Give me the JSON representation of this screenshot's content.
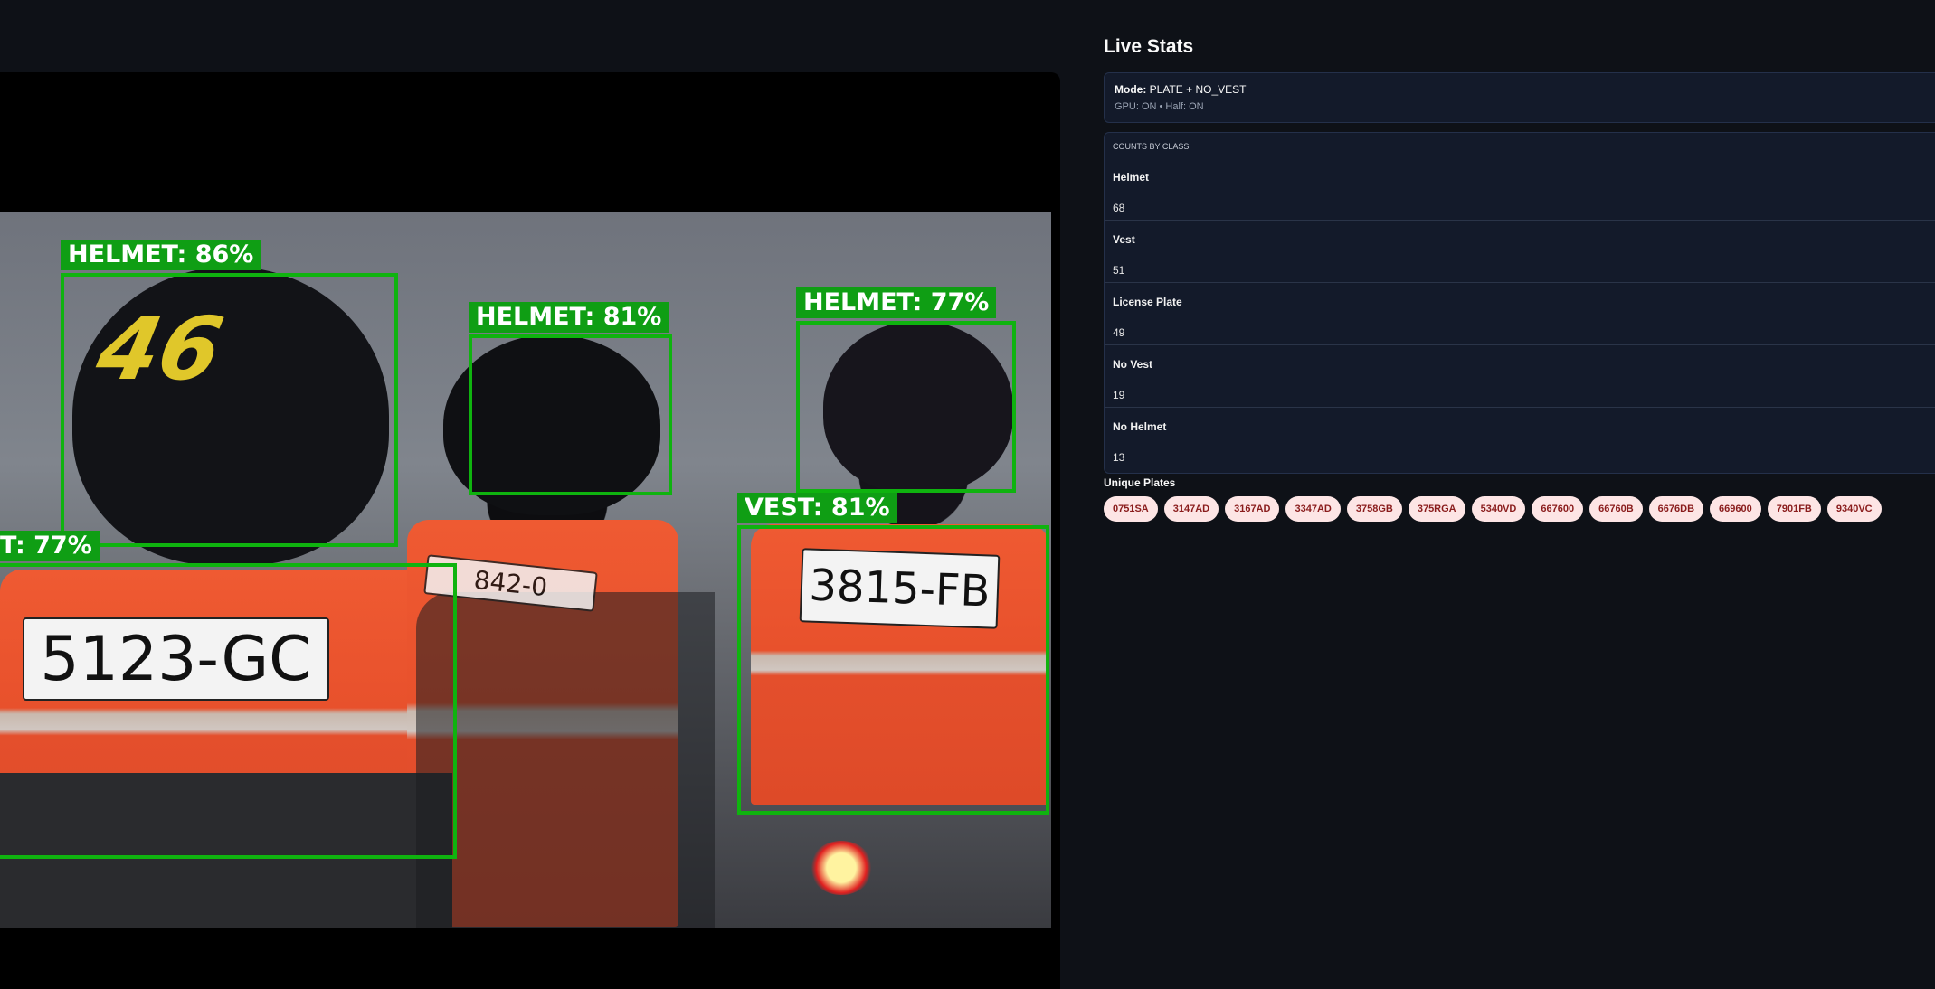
{
  "stats": {
    "title": "Live Stats",
    "mode_label": "Mode:",
    "mode_value": "PLATE + NO_VEST",
    "gpu_line": "GPU: ON • Half: ON",
    "counts_heading": "COUNTS BY CLASS",
    "counts": [
      {
        "label": "Helmet",
        "value": "68"
      },
      {
        "label": "Vest",
        "value": "51"
      },
      {
        "label": "License Plate",
        "value": "49"
      },
      {
        "label": "No Vest",
        "value": "19"
      },
      {
        "label": "No Helmet",
        "value": "13"
      }
    ],
    "plates_title": "Unique Plates",
    "plates": [
      "0751SA",
      "3147AD",
      "3167AD",
      "3347AD",
      "3758GB",
      "375RGA",
      "5340VD",
      "667600",
      "66760B",
      "6676DB",
      "669600",
      "7901FB",
      "9340VC"
    ]
  },
  "video": {
    "detections": [
      {
        "label": "HELMET: 86%"
      },
      {
        "label": "HELMET: 81%"
      },
      {
        "label": "HELMET: 77%"
      },
      {
        "label": "VEST: 81%"
      },
      {
        "label": "T: 77%"
      }
    ],
    "scene_text": {
      "helmet_number": "46",
      "plate_left": "5123-GC",
      "plate_right": "3815-FB",
      "plate_middle": "842-0"
    }
  },
  "colors": {
    "background": "#0e1117",
    "box_green": "#0fb30f",
    "chip_bg": "#fde5e5",
    "chip_text": "#8a1c1c"
  }
}
